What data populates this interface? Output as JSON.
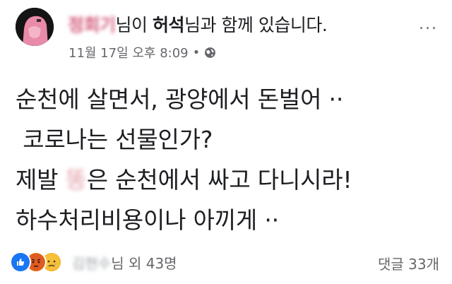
{
  "header": {
    "author_name": "정회기",
    "text_after_author": "님이 ",
    "tagged_name": "허석",
    "text_after_tagged": "님과 함께 있습니다."
  },
  "meta": {
    "timestamp": "11월 17일 오후 8:09",
    "separator": "•",
    "privacy_icon": "globe-icon"
  },
  "more_menu": {
    "label": "..."
  },
  "post": {
    "lines": [
      "순천에 살면서, 광양에서 돈벌어 ··",
      " 코로나는 선물인가?",
      "제발 ",
      "하수처리비용이나 아끼게 ··"
    ],
    "line3_blurred": "똥",
    "line3_rest": "은 순천에서 싸고 다니시라!"
  },
  "reactions": {
    "icons": [
      "like-icon",
      "angry-icon",
      "sad-icon"
    ],
    "blurred_name": "김현수",
    "summary_text": "님 외 43명"
  },
  "comments": {
    "label": "댓글 33개"
  },
  "colors": {
    "like": "#1877f2",
    "angry": "#e9710f",
    "sad": "#f7b125",
    "meta_text": "#65676b"
  }
}
